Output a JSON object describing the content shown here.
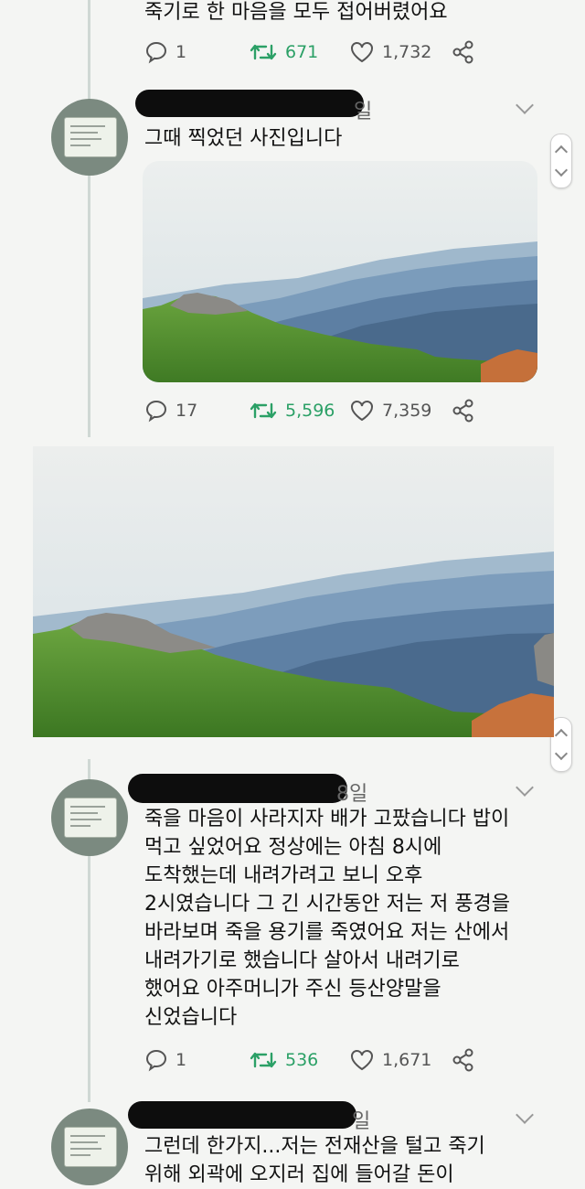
{
  "tweets": [
    {
      "text_lines": [
        "죽기로 한 마음을 모두 접어버렸어요"
      ],
      "replies": "1",
      "retweets": "671",
      "likes": "1,732"
    },
    {
      "date_tail": "일",
      "text_lines": [
        "그때 찍었던 사진입니다"
      ],
      "replies": "17",
      "retweets": "5,596",
      "likes": "7,359"
    },
    {
      "date_tail": "8일",
      "text_lines": [
        "죽을 마음이 사라지자 배가 고팠습니다 밥이",
        "먹고 싶었어요 정상에는 아침 8시에",
        "도착했는데 내려가려고 보니 오후",
        "2시였습니다 그 긴 시간동안 저는 저 풍경을",
        "바라보며 죽을 용기를 죽였어요 저는 산에서",
        "내려가기로 했습니다 살아서 내려기로",
        "했어요 아주머니가 주신 등산양말을",
        "신었습니다"
      ],
      "replies": "1",
      "retweets": "536",
      "likes": "1,671"
    },
    {
      "date_tail": "일",
      "text_lines": [
        "그런데 한가지...저는 전재산을 털고 죽기",
        "위해 외곽에 오지러 집에 들어갈 돈이"
      ]
    }
  ],
  "icons": {
    "reply": "speech-bubble-icon",
    "retweet": "retweet-icon",
    "like": "heart-icon",
    "share": "share-icon",
    "more": "chevron-down-icon"
  },
  "colors": {
    "retweet_green": "#2ba066",
    "background": "#f4f5f3",
    "text": "#111111"
  }
}
